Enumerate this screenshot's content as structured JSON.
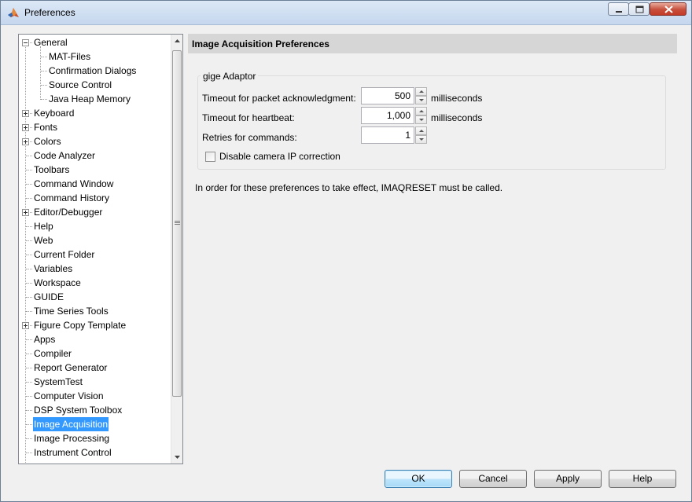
{
  "window": {
    "title": "Preferences"
  },
  "tree": {
    "items": [
      {
        "label": "General",
        "level": 0,
        "expander": "minus"
      },
      {
        "label": "MAT-Files",
        "level": 1
      },
      {
        "label": "Confirmation Dialogs",
        "level": 1
      },
      {
        "label": "Source Control",
        "level": 1
      },
      {
        "label": "Java Heap Memory",
        "level": 1
      },
      {
        "label": "Keyboard",
        "level": 0,
        "expander": "plus"
      },
      {
        "label": "Fonts",
        "level": 0,
        "expander": "plus"
      },
      {
        "label": "Colors",
        "level": 0,
        "expander": "plus"
      },
      {
        "label": "Code Analyzer",
        "level": 0
      },
      {
        "label": "Toolbars",
        "level": 0
      },
      {
        "label": "Command Window",
        "level": 0
      },
      {
        "label": "Command History",
        "level": 0
      },
      {
        "label": "Editor/Debugger",
        "level": 0,
        "expander": "plus"
      },
      {
        "label": "Help",
        "level": 0
      },
      {
        "label": "Web",
        "level": 0
      },
      {
        "label": "Current Folder",
        "level": 0
      },
      {
        "label": "Variables",
        "level": 0
      },
      {
        "label": "Workspace",
        "level": 0
      },
      {
        "label": "GUIDE",
        "level": 0
      },
      {
        "label": "Time Series Tools",
        "level": 0
      },
      {
        "label": "Figure Copy Template",
        "level": 0,
        "expander": "plus"
      },
      {
        "label": "Apps",
        "level": 0
      },
      {
        "label": "Compiler",
        "level": 0
      },
      {
        "label": "Report Generator",
        "level": 0
      },
      {
        "label": "SystemTest",
        "level": 0
      },
      {
        "label": "Computer Vision",
        "level": 0
      },
      {
        "label": "DSP System Toolbox",
        "level": 0
      },
      {
        "label": "Image Acquisition",
        "level": 0,
        "selected": true
      },
      {
        "label": "Image Processing",
        "level": 0
      },
      {
        "label": "Instrument Control",
        "level": 0
      }
    ]
  },
  "panel": {
    "title": "Image Acquisition Preferences",
    "group_title": "gige Adaptor",
    "fields": [
      {
        "label": "Timeout for packet acknowledgment:",
        "value": "500",
        "unit": "milliseconds"
      },
      {
        "label": "Timeout for heartbeat:",
        "value": "1,000",
        "unit": "milliseconds"
      },
      {
        "label": "Retries for commands:",
        "value": "1",
        "unit": ""
      }
    ],
    "checkbox": {
      "label": "Disable camera IP correction",
      "checked": false
    },
    "note": "In order for these preferences to take effect, IMAQRESET must be called."
  },
  "buttons": {
    "ok": "OK",
    "cancel": "Cancel",
    "apply": "Apply",
    "help": "Help"
  }
}
